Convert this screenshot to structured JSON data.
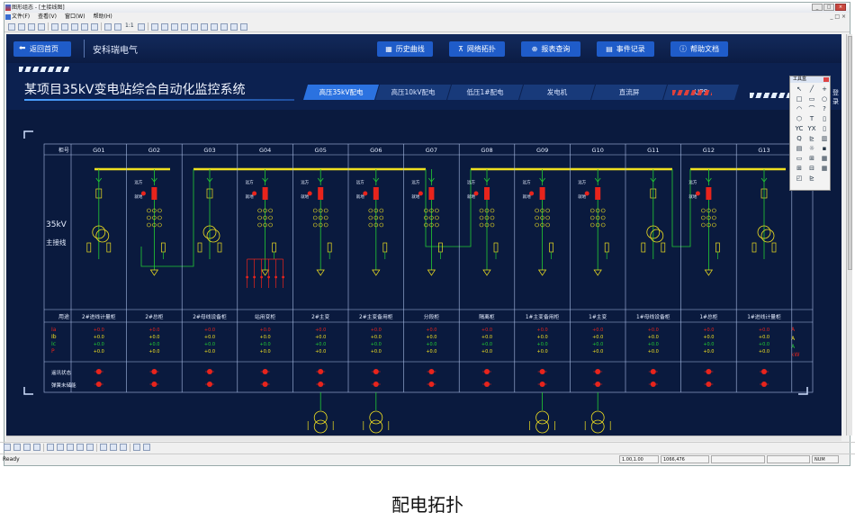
{
  "window": {
    "title": "图形组态 - [主接线图]",
    "buttons": [
      "_",
      "□",
      "×"
    ]
  },
  "menu": {
    "items": [
      "文件(F)",
      "查看(V)",
      "窗口(W)",
      "帮助(H)"
    ]
  },
  "toolbar": {
    "zoom_label": "1:1"
  },
  "nav": {
    "back_label": "返回首页",
    "brand": "安科瑞电气",
    "buttons": [
      {
        "label": "历史曲线",
        "icon": "chart-icon"
      },
      {
        "label": "网络拓扑",
        "icon": "topology-icon"
      },
      {
        "label": "报表查询",
        "icon": "search-icon"
      },
      {
        "label": "事件记录",
        "icon": "list-icon"
      },
      {
        "label": "帮助文档",
        "icon": "help-icon"
      }
    ]
  },
  "header": {
    "station_title": "某项目35kV变电站综合自动化监控系统",
    "login_label": "登录"
  },
  "tabs": [
    {
      "label": "高压35kV配电",
      "active": true
    },
    {
      "label": "高压10kV配电",
      "active": false
    },
    {
      "label": "低压1#配电",
      "active": false
    },
    {
      "label": "发电机",
      "active": false
    },
    {
      "label": "直流屏",
      "active": false
    },
    {
      "label": "UPS",
      "active": false
    }
  ],
  "toolbox": {
    "title": "工具盒",
    "tools": [
      "↖",
      "╱",
      "+",
      "□",
      "▭",
      "○",
      "◠",
      "⌒",
      "?",
      "⬡",
      "T",
      "▯",
      "YC",
      "YX",
      "▯",
      "Q",
      "⊵",
      "▥",
      "▤",
      "☼",
      "▪",
      "▭",
      "⊞",
      "▦",
      "⊞",
      "⊟",
      "▦",
      "◰",
      "⊵",
      ""
    ]
  },
  "diagram": {
    "header_label": "柜号",
    "bus_label": "35kV",
    "bus_label2": "主接线",
    "cabinets": [
      "G01",
      "G02",
      "G03",
      "G04",
      "G05",
      "G06",
      "G07",
      "G08",
      "G09",
      "G10",
      "G11",
      "G12",
      "G13"
    ],
    "usage_label": "用途",
    "usages": [
      "2#进线计量柜",
      "2#总柜",
      "2#母线设备柜",
      "站用变柜",
      "2#主变",
      "2#主变备用柜",
      "分段柜",
      "隔离柜",
      "1#主变备用柜",
      "1#主变",
      "1#母线设备柜",
      "1#总柜",
      "1#进线计量柜"
    ],
    "measurements": [
      "Ia",
      "Ib",
      "Ic",
      "P"
    ],
    "measure_value": "+0.0",
    "units": [
      "A",
      "A",
      "A",
      "kW"
    ],
    "status_labels": [
      "遥讯状态",
      "弹簧未储能"
    ],
    "switch_labels": [
      "远方",
      "就地"
    ]
  },
  "status": {
    "ready": "Ready",
    "coords": "1.00,1.00",
    "size": "1066,476",
    "num": "NUM"
  },
  "caption": "配电拓扑",
  "colors": {
    "canvas": "#0a1a3e",
    "bus": "#f0e020",
    "switch_red": "#e8241c",
    "switch_green": "#22cc33",
    "nav_button": "#1f5cc9"
  }
}
